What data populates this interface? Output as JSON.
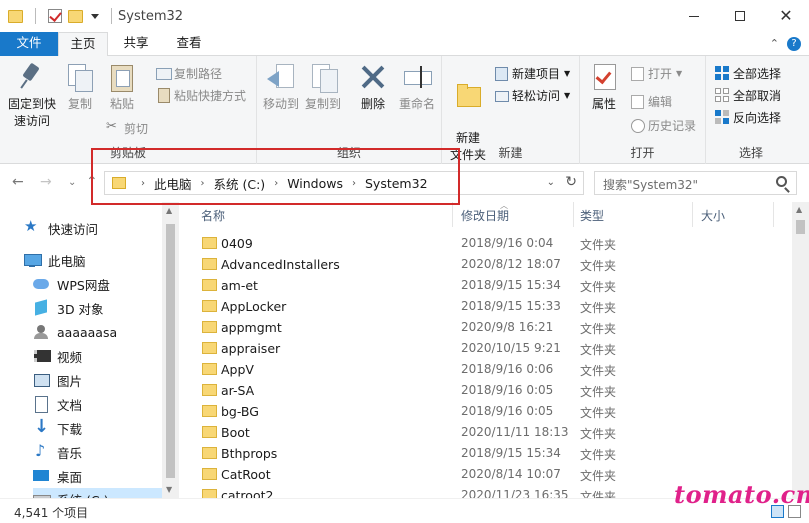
{
  "window": {
    "title": "System32"
  },
  "tabs": {
    "file": "文件",
    "home": "主页",
    "share": "共享",
    "view": "查看"
  },
  "ribbon": {
    "clipboard": {
      "label": "剪贴板",
      "pin": "固定到快速访问",
      "copy": "复制",
      "paste": "粘贴",
      "copy_path": "复制路径",
      "paste_shortcut": "粘贴快捷方式",
      "cut": "剪切"
    },
    "organize": {
      "label": "组织",
      "move_to": "移动到",
      "copy_to": "复制到",
      "delete": "删除",
      "rename": "重命名"
    },
    "new": {
      "label": "新建",
      "new_folder": "新建\n文件夹",
      "new_item": "新建项目",
      "easy_access": "轻松访问"
    },
    "open": {
      "label": "打开",
      "properties": "属性",
      "open": "打开",
      "edit": "编辑",
      "history": "历史记录"
    },
    "select": {
      "label": "选择",
      "select_all": "全部选择",
      "select_none": "全部取消",
      "invert": "反向选择"
    }
  },
  "address": {
    "crumbs": [
      "此电脑",
      "系统 (C:)",
      "Windows",
      "System32"
    ],
    "search_placeholder": "搜索\"System32\""
  },
  "nav": {
    "quick_access": "快速访问",
    "this_pc": "此电脑",
    "items": [
      "WPS网盘",
      "3D 对象",
      "aaaaaasa",
      "视频",
      "图片",
      "文档",
      "下载",
      "音乐",
      "桌面",
      "系统 (C:)"
    ]
  },
  "columns": {
    "name": "名称",
    "modified": "修改日期",
    "type": "类型",
    "size": "大小"
  },
  "files": [
    {
      "name": "0409",
      "date": "2018/9/16 0:04",
      "type": "文件夹"
    },
    {
      "name": "AdvancedInstallers",
      "date": "2020/8/12 18:07",
      "type": "文件夹"
    },
    {
      "name": "am-et",
      "date": "2018/9/15 15:34",
      "type": "文件夹"
    },
    {
      "name": "AppLocker",
      "date": "2018/9/15 15:33",
      "type": "文件夹"
    },
    {
      "name": "appmgmt",
      "date": "2020/9/8 16:21",
      "type": "文件夹"
    },
    {
      "name": "appraiser",
      "date": "2020/10/15 9:21",
      "type": "文件夹"
    },
    {
      "name": "AppV",
      "date": "2018/9/16 0:06",
      "type": "文件夹"
    },
    {
      "name": "ar-SA",
      "date": "2018/9/16 0:05",
      "type": "文件夹"
    },
    {
      "name": "bg-BG",
      "date": "2018/9/16 0:05",
      "type": "文件夹"
    },
    {
      "name": "Boot",
      "date": "2020/11/11 18:13",
      "type": "文件夹"
    },
    {
      "name": "Bthprops",
      "date": "2018/9/15 15:34",
      "type": "文件夹"
    },
    {
      "name": "CatRoot",
      "date": "2020/8/14 10:07",
      "type": "文件夹"
    },
    {
      "name": "catroot2",
      "date": "2020/11/23 16:35",
      "type": "文件夹"
    }
  ],
  "status": {
    "count": "4,541 个项目"
  },
  "watermark": "tomato.cm",
  "colors": {
    "accent": "#1979ca",
    "highlight_box": "#d22a2a",
    "watermark": "#e0218a",
    "folder": "#f8d775"
  }
}
